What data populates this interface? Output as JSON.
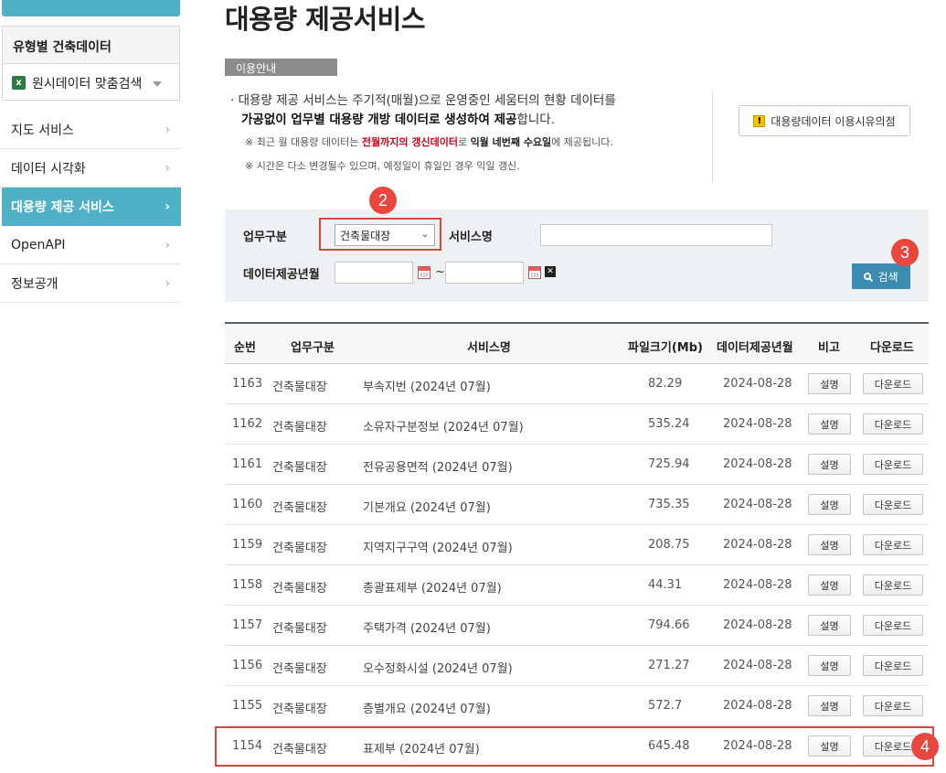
{
  "sidebar": {
    "box_title": "유형별 건축데이터",
    "box_sub": "원시데이터 맞춤검색",
    "xls_icon_glyph": "x",
    "items": [
      {
        "label": "지도 서비스",
        "active": false
      },
      {
        "label": "데이터 시각화",
        "active": false
      },
      {
        "label": "대용량 제공 서비스",
        "active": true
      },
      {
        "label": "OpenAPI",
        "active": false
      },
      {
        "label": "정보공개",
        "active": false
      }
    ]
  },
  "main": {
    "title": "대용량 제공서비스",
    "info_tag": "이용안내",
    "info_line1": "· 대용량 제공 서비스는 주기적(매월)으로 운영중인 세움터의 현황 데이터를",
    "info_line2_bold": "가공없이 업무별 대용량 개방 데이터로 생성하여 제공",
    "info_line2_rest": "합니다.",
    "note1_pre": "※ 최근 월 대용량 데이터는 ",
    "note1_red": "전월까지의 갱신데이터",
    "note1_mid": "로 ",
    "note1_bold": "익월 네번째 수요일",
    "note1_post": "에 제공됩니다.",
    "note2": "※ 시간은 다소 변경될수 있으며, 예정일이 휴일인 경우 익일 갱신.",
    "notice_button": "대용량데이터 이용시유의점",
    "notice_icon_glyph": "!"
  },
  "search": {
    "type_label": "업무구분",
    "type_value": "건축물대장",
    "type_caret": "⌄",
    "service_label": "서비스명",
    "service_value": "",
    "date_label": "데이터제공년월",
    "date_from": "",
    "date_to": "",
    "tilde": "~",
    "clear_glyph": "✕",
    "search_button": "검색"
  },
  "markers": {
    "m2": "2",
    "m3": "3",
    "m4": "4"
  },
  "table": {
    "headers": {
      "seq": "순번",
      "type": "업무구분",
      "service": "서비스명",
      "size": "파일크기(Mb)",
      "date": "데이터제공년월",
      "note": "비고",
      "download": "다운로드"
    },
    "rows": [
      {
        "seq": "1163",
        "type": "건축물대장",
        "service": "부속지번 (2024년 07월)",
        "size": "82.29",
        "date": "2024-08-28",
        "desc_btn": "설명",
        "dl_btn": "다운로드"
      },
      {
        "seq": "1162",
        "type": "건축물대장",
        "service": "소유자구분정보 (2024년 07월)",
        "size": "535.24",
        "date": "2024-08-28",
        "desc_btn": "설명",
        "dl_btn": "다운로드"
      },
      {
        "seq": "1161",
        "type": "건축물대장",
        "service": "전유공용면적 (2024년 07월)",
        "size": "725.94",
        "date": "2024-08-28",
        "desc_btn": "설명",
        "dl_btn": "다운로드"
      },
      {
        "seq": "1160",
        "type": "건축물대장",
        "service": "기본개요 (2024년 07월)",
        "size": "735.35",
        "date": "2024-08-28",
        "desc_btn": "설명",
        "dl_btn": "다운로드"
      },
      {
        "seq": "1159",
        "type": "건축물대장",
        "service": "지역지구구역 (2024년 07월)",
        "size": "208.75",
        "date": "2024-08-28",
        "desc_btn": "설명",
        "dl_btn": "다운로드"
      },
      {
        "seq": "1158",
        "type": "건축물대장",
        "service": "총괄표제부 (2024년 07월)",
        "size": "44.31",
        "date": "2024-08-28",
        "desc_btn": "설명",
        "dl_btn": "다운로드"
      },
      {
        "seq": "1157",
        "type": "건축물대장",
        "service": "주택가격 (2024년 07월)",
        "size": "794.66",
        "date": "2024-08-28",
        "desc_btn": "설명",
        "dl_btn": "다운로드"
      },
      {
        "seq": "1156",
        "type": "건축물대장",
        "service": "오수정화시설 (2024년 07월)",
        "size": "271.27",
        "date": "2024-08-28",
        "desc_btn": "설명",
        "dl_btn": "다운로드"
      },
      {
        "seq": "1155",
        "type": "건축물대장",
        "service": "층별개요 (2024년 07월)",
        "size": "572.7",
        "date": "2024-08-28",
        "desc_btn": "설명",
        "dl_btn": "다운로드"
      },
      {
        "seq": "1154",
        "type": "건축물대장",
        "service": "표제부 (2024년 07월)",
        "size": "645.48",
        "date": "2024-08-28",
        "desc_btn": "설명",
        "dl_btn": "다운로드"
      }
    ]
  }
}
